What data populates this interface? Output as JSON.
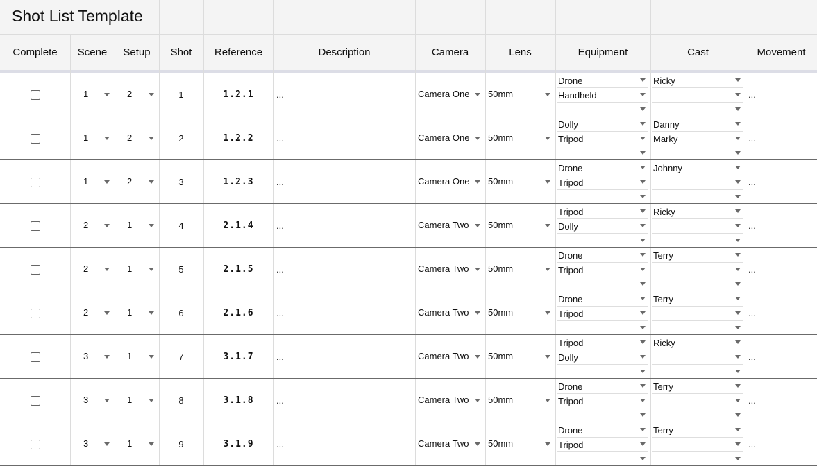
{
  "title": "Shot List Template",
  "columns": [
    {
      "key": "complete",
      "label": "Complete"
    },
    {
      "key": "scene",
      "label": "Scene"
    },
    {
      "key": "setup",
      "label": "Setup"
    },
    {
      "key": "shot",
      "label": "Shot"
    },
    {
      "key": "reference",
      "label": "Reference"
    },
    {
      "key": "description",
      "label": "Description"
    },
    {
      "key": "camera",
      "label": "Camera"
    },
    {
      "key": "lens",
      "label": "Lens"
    },
    {
      "key": "equipment",
      "label": "Equipment"
    },
    {
      "key": "cast",
      "label": "Cast"
    },
    {
      "key": "movement",
      "label": "Movement"
    }
  ],
  "rows": [
    {
      "complete": false,
      "scene": "1",
      "setup": "2",
      "shot": "1",
      "reference": "1.2.1",
      "description": "...",
      "camera": "Camera One",
      "lens": "50mm",
      "equipment": [
        "Drone",
        "Handheld",
        ""
      ],
      "cast": [
        "Ricky",
        "",
        ""
      ],
      "movement": "..."
    },
    {
      "complete": false,
      "scene": "1",
      "setup": "2",
      "shot": "2",
      "reference": "1.2.2",
      "description": "...",
      "camera": "Camera One",
      "lens": "50mm",
      "equipment": [
        "Dolly",
        "Tripod",
        ""
      ],
      "cast": [
        "Danny",
        "Marky",
        ""
      ],
      "movement": "..."
    },
    {
      "complete": false,
      "scene": "1",
      "setup": "2",
      "shot": "3",
      "reference": "1.2.3",
      "description": "...",
      "camera": "Camera One",
      "lens": "50mm",
      "equipment": [
        "Drone",
        "Tripod",
        ""
      ],
      "cast": [
        "Johnny",
        "",
        ""
      ],
      "movement": "..."
    },
    {
      "complete": false,
      "scene": "2",
      "setup": "1",
      "shot": "4",
      "reference": "2.1.4",
      "description": "...",
      "camera": "Camera Two",
      "lens": "50mm",
      "equipment": [
        "Tripod",
        "Dolly",
        ""
      ],
      "cast": [
        "Ricky",
        "",
        ""
      ],
      "movement": "..."
    },
    {
      "complete": false,
      "scene": "2",
      "setup": "1",
      "shot": "5",
      "reference": "2.1.5",
      "description": "...",
      "camera": "Camera Two",
      "lens": "50mm",
      "equipment": [
        "Drone",
        "Tripod",
        ""
      ],
      "cast": [
        "Terry",
        "",
        ""
      ],
      "movement": "..."
    },
    {
      "complete": false,
      "scene": "2",
      "setup": "1",
      "shot": "6",
      "reference": "2.1.6",
      "description": "...",
      "camera": "Camera Two",
      "lens": "50mm",
      "equipment": [
        "Drone",
        "Tripod",
        ""
      ],
      "cast": [
        "Terry",
        "",
        ""
      ],
      "movement": "..."
    },
    {
      "complete": false,
      "scene": "3",
      "setup": "1",
      "shot": "7",
      "reference": "3.1.7",
      "description": "...",
      "camera": "Camera Two",
      "lens": "50mm",
      "equipment": [
        "Tripod",
        "Dolly",
        ""
      ],
      "cast": [
        "Ricky",
        "",
        ""
      ],
      "movement": "..."
    },
    {
      "complete": false,
      "scene": "3",
      "setup": "1",
      "shot": "8",
      "reference": "3.1.8",
      "description": "...",
      "camera": "Camera Two",
      "lens": "50mm",
      "equipment": [
        "Drone",
        "Tripod",
        ""
      ],
      "cast": [
        "Terry",
        "",
        ""
      ],
      "movement": "..."
    },
    {
      "complete": false,
      "scene": "3",
      "setup": "1",
      "shot": "9",
      "reference": "3.1.9",
      "description": "...",
      "camera": "Camera Two",
      "lens": "50mm",
      "equipment": [
        "Drone",
        "Tripod",
        ""
      ],
      "cast": [
        "Terry",
        "",
        ""
      ],
      "movement": "..."
    }
  ]
}
